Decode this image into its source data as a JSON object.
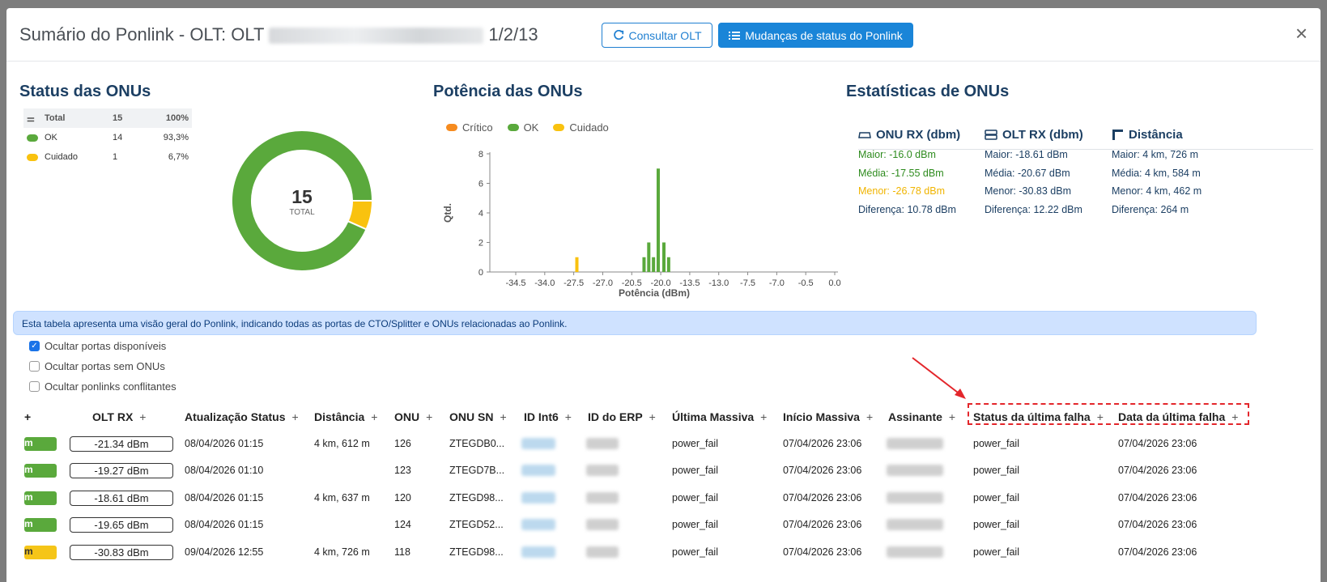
{
  "header": {
    "title_prefix": "Sumário do Ponlink - OLT: OLT",
    "title_suffix": "1/2/13",
    "consultar_label": "Consultar OLT",
    "mudancas_label": "Mudanças de status do Ponlink",
    "close_label": "×"
  },
  "status": {
    "title": "Status das ONUs",
    "rows": [
      {
        "label": "Total",
        "count": "15",
        "pct": "100%"
      },
      {
        "label": "OK",
        "count": "14",
        "pct": "93,3%"
      },
      {
        "label": "Cuidado",
        "count": "1",
        "pct": "6,7%"
      }
    ],
    "donut_total": "15",
    "donut_caption": "TOTAL",
    "colors": {
      "ok": "#5aa93c",
      "cuidado": "#f9c20f",
      "critico": "#f68b1f"
    }
  },
  "potencia": {
    "title": "Potência das ONUs",
    "legend": [
      "Crítico",
      "OK",
      "Cuidado"
    ]
  },
  "chart_data": {
    "type": "bar",
    "xlabel": "Potência (dBm)",
    "ylabel": "Qtd.",
    "ylim": [
      0,
      8
    ],
    "yticks": [
      "0",
      "2",
      "4",
      "6",
      "8"
    ],
    "xticks": [
      "-34.5",
      "-34.0",
      "-27.5",
      "-27.0",
      "-20.5",
      "-20.0",
      "-13.5",
      "-13.0",
      "-7.5",
      "-7.0",
      "-0.5",
      "0.0"
    ],
    "bars": [
      {
        "x": -26.8,
        "value": 1,
        "series": "Cuidado"
      },
      {
        "x": -19.7,
        "value": 1,
        "series": "OK"
      },
      {
        "x": -19.2,
        "value": 2,
        "series": "OK"
      },
      {
        "x": -18.7,
        "value": 1,
        "series": "OK"
      },
      {
        "x": -18.2,
        "value": 7,
        "series": "OK"
      },
      {
        "x": -17.6,
        "value": 2,
        "series": "OK"
      },
      {
        "x": -17.1,
        "value": 1,
        "series": "OK"
      }
    ]
  },
  "estatisticas": {
    "title": "Estatísticas de ONUs",
    "columns": [
      {
        "head": "ONU RX (dbm)",
        "lines": [
          "Maior: -16.0 dBm",
          "Média: -17.55 dBm",
          "Menor: -26.78 dBm",
          "Diferença: 10.78 dBm"
        ]
      },
      {
        "head": "OLT RX (dbm)",
        "lines": [
          "Maior: -18.61 dBm",
          "Média: -20.67 dBm",
          "Menor: -30.83 dBm",
          "Diferença: 12.22 dBm"
        ]
      },
      {
        "head": "Distância",
        "lines": [
          "Maior: 4 km, 726 m",
          "Média: 4 km, 584 m",
          "Menor: 4 km, 462 m",
          "Diferença: 264 m"
        ]
      }
    ]
  },
  "info_text": "Esta tabela apresenta uma visão geral do Ponlink, indicando todas as portas de CTO/Splitter e ONUs relacionadas ao Ponlink.",
  "filters": [
    {
      "label": "Ocultar portas disponíveis",
      "checked": true
    },
    {
      "label": "Ocultar portas sem ONUs",
      "checked": false
    },
    {
      "label": "Ocultar ponlinks conflitantes",
      "checked": false
    }
  ],
  "table": {
    "headers": [
      "+",
      "OLT RX",
      "Atualização Status",
      "Distância",
      "ONU",
      "ONU SN",
      "ID Int6",
      "ID do ERP",
      "Última Massiva",
      "Início Massiva",
      "Assinante",
      "Status da última falha",
      "Data da última falha"
    ],
    "rows": [
      {
        "pill": "m",
        "olt_rx": "-21.34 dBm",
        "atualizacao": "08/04/2026 01:15",
        "distancia": "4 km, 612 m",
        "onu": "126",
        "sn": "ZTEGDB0...",
        "massiva": "power_fail",
        "inicio": "07/04/2026 23:06",
        "status_falha": "power_fail",
        "data_falha": "07/04/2026 23:06"
      },
      {
        "pill": "m",
        "olt_rx": "-19.27 dBm",
        "atualizacao": "08/04/2026 01:10",
        "distancia": "",
        "onu": "123",
        "sn": "ZTEGD7B...",
        "massiva": "power_fail",
        "inicio": "07/04/2026 23:06",
        "status_falha": "power_fail",
        "data_falha": "07/04/2026 23:06"
      },
      {
        "pill": "m",
        "olt_rx": "-18.61 dBm",
        "atualizacao": "08/04/2026 01:15",
        "distancia": "4 km, 637 m",
        "onu": "120",
        "sn": "ZTEGD98...",
        "massiva": "power_fail",
        "inicio": "07/04/2026 23:06",
        "status_falha": "power_fail",
        "data_falha": "07/04/2026 23:06"
      },
      {
        "pill": "m",
        "olt_rx": "-19.65 dBm",
        "atualizacao": "08/04/2026 01:15",
        "distancia": "",
        "onu": "124",
        "sn": "ZTEGD52...",
        "massiva": "power_fail",
        "inicio": "07/04/2026 23:06",
        "status_falha": "power_fail",
        "data_falha": "07/04/2026 23:06"
      },
      {
        "pill": "m",
        "olt_rx": "-30.83 dBm",
        "atualizacao": "09/04/2026 12:55",
        "distancia": "4 km, 726 m",
        "onu": "118",
        "sn": "ZTEGD98...",
        "massiva": "power_fail",
        "inicio": "07/04/2026 23:06",
        "status_falha": "power_fail",
        "data_falha": "07/04/2026 23:06"
      }
    ]
  }
}
